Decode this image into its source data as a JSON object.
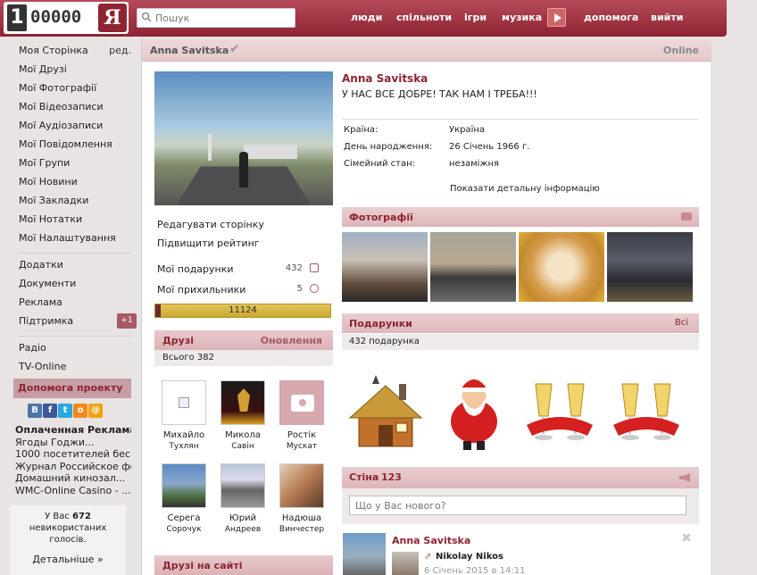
{
  "logo": {
    "one": "1",
    "num": "00000",
    "ya": "Я"
  },
  "search": {
    "placeholder": "Пошук"
  },
  "topnav": [
    "люди",
    "спільноти",
    "ігри",
    "музика",
    "допомога",
    "вийти"
  ],
  "leftnav": {
    "edit_label": "ред.",
    "group1": [
      "Моя Сторінка",
      "Мої Друзі",
      "Мої Фотографії",
      "Мої Відеозаписи",
      "Мої Аудіозаписи",
      "Мої Повідомлення",
      "Мої Групи",
      "Мої Новини",
      "Мої Закладки",
      "Мої Нотатки",
      "Мої Налаштування"
    ],
    "group2": [
      "Додатки",
      "Документи",
      "Реклама",
      "Підтримка"
    ],
    "support_badge": "+1",
    "group3": [
      "Радіо",
      "TV-Online"
    ]
  },
  "help": {
    "title": "Допомога проекту",
    "social": [
      {
        "name": "vk",
        "glyph": "В",
        "color": "#4a76a8"
      },
      {
        "name": "facebook",
        "glyph": "f",
        "color": "#3b5998"
      },
      {
        "name": "twitter",
        "glyph": "t",
        "color": "#2aa9e0"
      },
      {
        "name": "odnoklassniki",
        "glyph": "о",
        "color": "#f28a1b"
      },
      {
        "name": "mailru",
        "glyph": "@",
        "color": "#f0a30a"
      }
    ],
    "paid_title": "Оплаченная Реклама:",
    "ads": [
      "Ягоды Годжи...",
      "1000 посетителей бес...",
      "Журнал Российское фо...",
      "Домашний кинозал...",
      "WMC-Online Casino - ..."
    ]
  },
  "votes": {
    "prefix": "У Вас",
    "count": "672",
    "line2": "невикористаних",
    "line3": "голосів.",
    "more": "Детальніше »"
  },
  "header": {
    "name": "Anna Savitska",
    "online": "Online"
  },
  "actions": {
    "edit_page": "Редагувати сторінку",
    "raise_rating": "Підвищити рейтинг",
    "gifts_label": "Мої подарунки",
    "gifts_count": "432",
    "fans_label": "Мої прихильники",
    "fans_count": "5",
    "rating_value": "11124"
  },
  "friends": {
    "title": "Друзі",
    "updates": "Оновлення",
    "total": "Всього 382",
    "list": [
      {
        "first": "Михайло",
        "last": "Тухлян"
      },
      {
        "first": "Микола",
        "last": "Савін"
      },
      {
        "first": "Ростік",
        "last": "Мускат"
      },
      {
        "first": "Серега",
        "last": "Сорочук"
      },
      {
        "first": "Юрий",
        "last": "Андреев"
      },
      {
        "first": "Надюша",
        "last": "Винчестер"
      }
    ],
    "online_title": "Друзі на сайті"
  },
  "profile": {
    "name": "Anna Savitska",
    "status": "У НАС ВСЕ ДОБРЕ! ТАК НАМ І ТРЕБА!!!",
    "country_label": "Країна:",
    "country": "Україна",
    "birthday_label": "День народження:",
    "birthday": "26 Січень 1966 г.",
    "family_label": "Сімейний стан:",
    "family": "незаміжня",
    "more": "Показати детальну інформацію"
  },
  "photos": {
    "title": "Фотографії"
  },
  "gifts": {
    "title": "Подарунки",
    "all": "Всі",
    "count": "432 подарунка"
  },
  "wall": {
    "title": "Стіна",
    "count": "123",
    "placeholder": "Що у Вас нового?",
    "post_author": "Anna Savitska",
    "post_shared_from": "Nikolay Nikos",
    "post_date": "6 Січень 2015 в 14:11"
  }
}
